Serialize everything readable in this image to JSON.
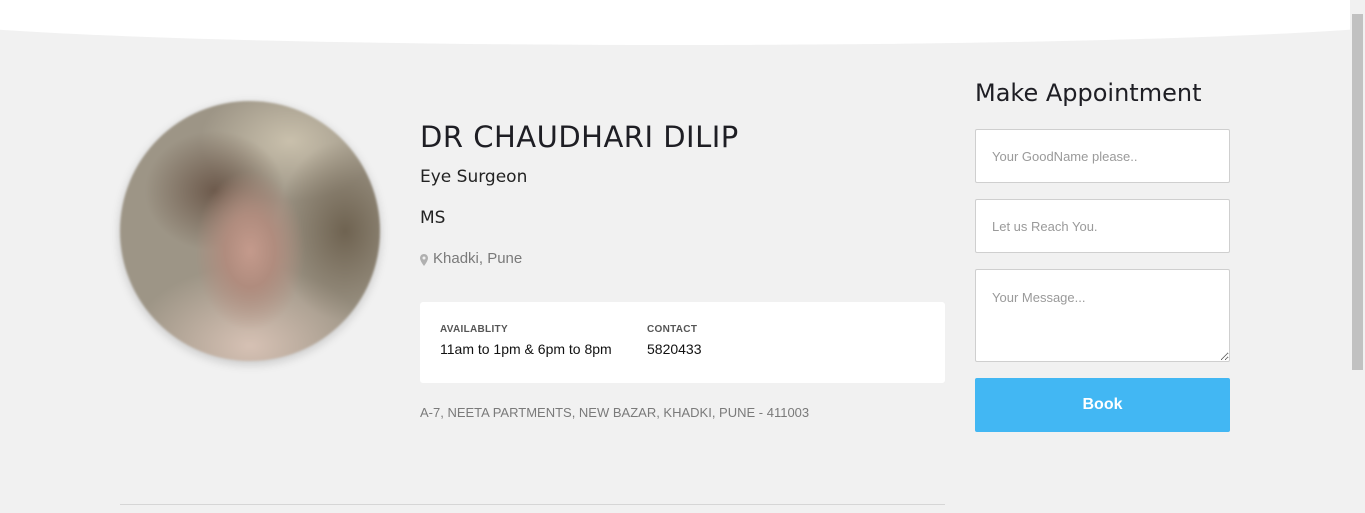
{
  "doctor": {
    "name": "DR CHAUDHARI DILIP",
    "specialty": "Eye Surgeon",
    "degree": "MS",
    "location": "Khadki, Pune",
    "availability_label": "AVAILABLITY",
    "availability_value": "11am to 1pm & 6pm to 8pm",
    "contact_label": "CONTACT",
    "contact_value": "5820433",
    "address": "A-7, NEETA PARTMENTS, NEW BAZAR, KHADKI, PUNE - 411003"
  },
  "appointment": {
    "title": "Make Appointment",
    "name_placeholder": "Your GoodName please..",
    "contact_placeholder": "Let us Reach You.",
    "message_placeholder": "Your Message...",
    "book_label": "Book"
  },
  "colors": {
    "accent": "#42b7f3",
    "background": "#f1f1f1",
    "card": "#ffffff"
  },
  "icons": {
    "location": "map-pin-icon"
  }
}
